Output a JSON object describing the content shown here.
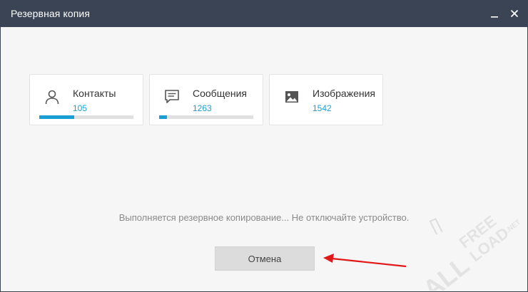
{
  "window": {
    "title": "Резервная копия",
    "controls": [
      {
        "icon": "minimize-icon"
      },
      {
        "icon": "close-icon"
      }
    ]
  },
  "cards": [
    {
      "icon": "contact-icon",
      "label": "Контакты",
      "count": "105",
      "progress": 0.37
    },
    {
      "icon": "message-icon",
      "label": "Сообщения",
      "count": "1263",
      "progress": 0.08
    },
    {
      "icon": "image-icon",
      "label": "Изображения",
      "count": "1542",
      "progress": 0.0
    }
  ],
  "status_text": "Выполняется резервное копирование... Не отключайте устройство.",
  "cancel_label": "Отмена",
  "watermark": {
    "top": "FREE",
    "bottom": "LOAD",
    "left": "ALL",
    "suffix": ".NET"
  },
  "colors": {
    "titlebar": "#3b4454",
    "accent": "#1a9fd4",
    "annotation_arrow": "#e01818"
  }
}
